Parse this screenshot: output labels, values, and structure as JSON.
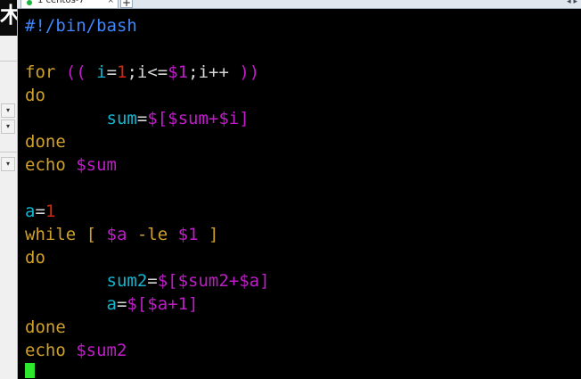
{
  "tab": {
    "number": "1",
    "title": "centos-7",
    "close": "×",
    "add": "+"
  },
  "terminal": {
    "lines": [
      [
        {
          "t": "#!/bin/bash",
          "c": "c-blue"
        }
      ],
      [],
      [
        {
          "t": "for",
          "c": "c-tan"
        },
        {
          "t": " ",
          "c": "c-wht"
        },
        {
          "t": "((",
          "c": "c-mag"
        },
        {
          "t": " i",
          "c": "c-cyan"
        },
        {
          "t": "=",
          "c": "c-wht"
        },
        {
          "t": "1",
          "c": "c-red"
        },
        {
          "t": ";i<=",
          "c": "c-wht"
        },
        {
          "t": "$1",
          "c": "c-mag"
        },
        {
          "t": ";i++ ",
          "c": "c-wht"
        },
        {
          "t": "))",
          "c": "c-mag"
        }
      ],
      [
        {
          "t": "do",
          "c": "c-tan"
        }
      ],
      [
        {
          "t": "        sum",
          "c": "c-cyan"
        },
        {
          "t": "=",
          "c": "c-wht"
        },
        {
          "t": "$[$sum+$i]",
          "c": "c-mag"
        }
      ],
      [
        {
          "t": "done",
          "c": "c-tan"
        }
      ],
      [
        {
          "t": "echo ",
          "c": "c-tan"
        },
        {
          "t": "$sum",
          "c": "c-mag"
        }
      ],
      [],
      [
        {
          "t": "a",
          "c": "c-cyan"
        },
        {
          "t": "=",
          "c": "c-wht"
        },
        {
          "t": "1",
          "c": "c-red"
        }
      ],
      [
        {
          "t": "while",
          "c": "c-tan"
        },
        {
          "t": " [ ",
          "c": "c-tan"
        },
        {
          "t": "$a",
          "c": "c-mag"
        },
        {
          "t": " -le ",
          "c": "c-tan"
        },
        {
          "t": "$1",
          "c": "c-mag"
        },
        {
          "t": " ]",
          "c": "c-tan"
        }
      ],
      [
        {
          "t": "do",
          "c": "c-tan"
        }
      ],
      [
        {
          "t": "        sum2",
          "c": "c-cyan"
        },
        {
          "t": "=",
          "c": "c-wht"
        },
        {
          "t": "$[$sum2+$a]",
          "c": "c-mag"
        }
      ],
      [
        {
          "t": "        a",
          "c": "c-cyan"
        },
        {
          "t": "=",
          "c": "c-wht"
        },
        {
          "t": "$[$a+1]",
          "c": "c-mag"
        }
      ],
      [
        {
          "t": "done",
          "c": "c-tan"
        }
      ],
      [
        {
          "t": "echo ",
          "c": "c-tan"
        },
        {
          "t": "$sum2",
          "c": "c-mag"
        }
      ]
    ]
  },
  "colors": {
    "background": "#000000",
    "cursor": "#2de82d",
    "keyword": "#cfa12a",
    "variable": "#12b5cf",
    "expansion": "#c01cc9",
    "number": "#d12a0f",
    "shebang": "#3e86ff"
  }
}
